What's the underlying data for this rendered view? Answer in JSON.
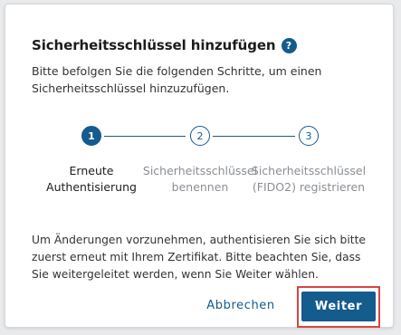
{
  "dialog": {
    "title": "Sicherheitsschlüssel hinzufügen",
    "help_icon": "?",
    "intro": "Bitte befolgen Sie die folgenden Schritte, um einen Sicherheitsschlüssel hinzuzufügen."
  },
  "stepper": {
    "steps": [
      {
        "number": "1",
        "label": "Erneute Authentisierung",
        "state": "active"
      },
      {
        "number": "2",
        "label": "Sicherheitsschlüssel benennen",
        "state": "inactive"
      },
      {
        "number": "3",
        "label": "Sicherheitsschlüssel (FIDO2) registrieren",
        "state": "inactive"
      }
    ]
  },
  "info_text": "Um Änderungen vorzunehmen, authentisieren Sie sich bitte zuerst erneut mit Ihrem Zertifikat. Bitte beachten Sie, dass Sie weitergeleitet werden, wenn Sie Weiter wählen.",
  "actions": {
    "cancel_label": "Abbrechen",
    "next_label": "Weiter"
  },
  "colors": {
    "primary": "#145b8e",
    "highlight": "#d64545",
    "muted_text": "#8a8e93"
  }
}
